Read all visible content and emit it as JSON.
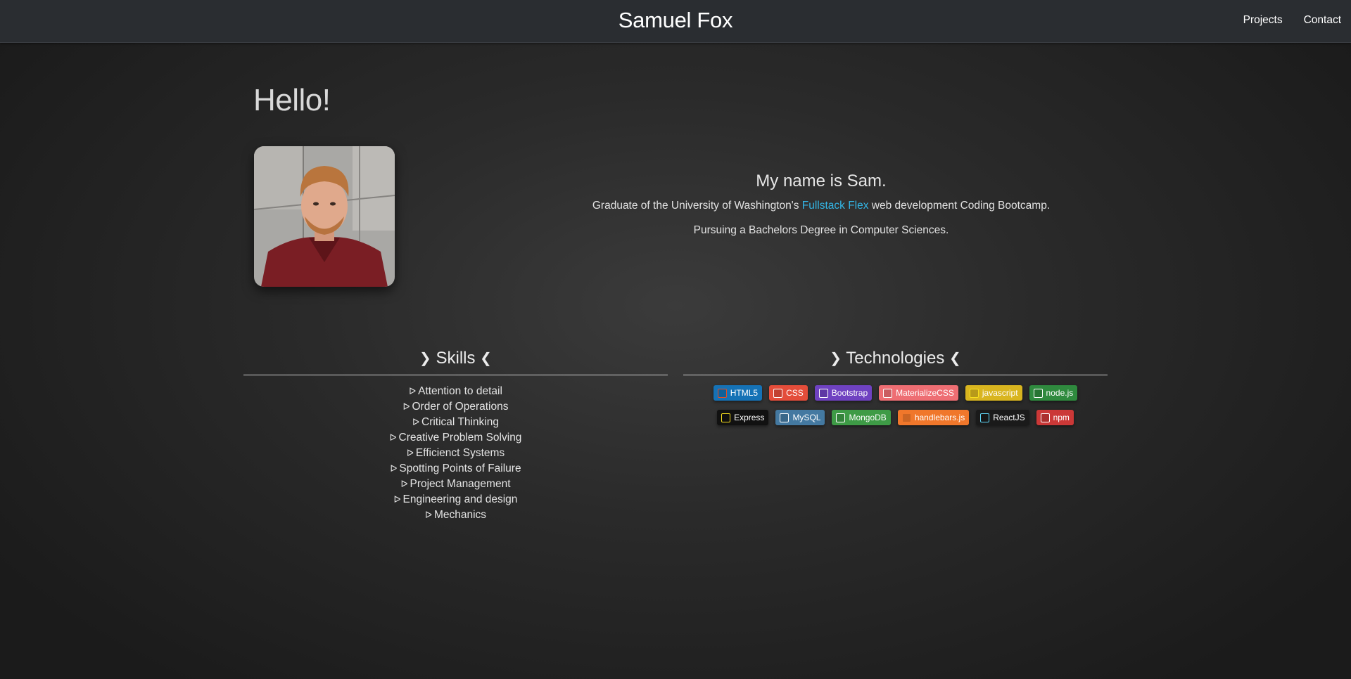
{
  "navbar": {
    "brand": "Samuel Fox",
    "links": [
      "Projects",
      "Contact"
    ]
  },
  "hero": {
    "greeting": "Hello!",
    "intro_title": "My name is Sam.",
    "line1_before": "Graduate of the University of Washington's ",
    "line1_link": "Fullstack Flex",
    "line1_after": " web development Coding Bootcamp.",
    "line2": "Pursuing a Bachelors Degree in Computer Sciences."
  },
  "skills": {
    "title": "Skills",
    "chevron_left": "❯",
    "chevron_right": "❮",
    "bullet": "ᐅ",
    "items": [
      "Attention to detail",
      "Order of Operations",
      "Critical Thinking",
      "Creative Problem Solving",
      "Efficienct Systems",
      "Spotting Points of Failure",
      "Project Management",
      "Engineering and design",
      "Mechanics"
    ]
  },
  "technologies": {
    "title": "Technologies",
    "badges": [
      {
        "label": "HTML5",
        "icon": "html5-icon",
        "color": "#1572b6",
        "icon_color": "#e34f26"
      },
      {
        "label": "CSS",
        "icon": "css3-icon",
        "color": "#e44d3a",
        "icon_color": "#ffffff"
      },
      {
        "label": "Bootstrap",
        "icon": "bootstrap-icon",
        "color": "#6f42c1",
        "icon_color": "#ffffff"
      },
      {
        "label": "MaterializeCSS",
        "icon": "materialize-icon",
        "color": "#ee6e73",
        "icon_color": "#ffffff"
      },
      {
        "label": "javascript",
        "icon": "javascript-icon",
        "color": "#d9b51f",
        "icon_color": "#f7df1e"
      },
      {
        "label": "node.js",
        "icon": "nodejs-icon",
        "color": "#2f8a3e",
        "icon_color": "#ffffff"
      },
      {
        "label": "Express",
        "icon": "express-icon",
        "color": "#111111",
        "icon_color": "#f7df1e"
      },
      {
        "label": "MySQL",
        "icon": "mysql-icon",
        "color": "#4479a1",
        "icon_color": "#ffffff"
      },
      {
        "label": "MongoDB",
        "icon": "mongodb-icon",
        "color": "#3e9b46",
        "icon_color": "#ffffff"
      },
      {
        "label": "handlebars.js",
        "icon": "handlebars-icon",
        "color": "#f0772b",
        "icon_color": "#f0772b"
      },
      {
        "label": "ReactJS",
        "icon": "react-icon",
        "color": "#1a1a1a",
        "icon_color": "#61dafb"
      },
      {
        "label": "npm",
        "icon": "npm-icon",
        "color": "#cb3837",
        "icon_color": "#ffffff"
      }
    ]
  }
}
